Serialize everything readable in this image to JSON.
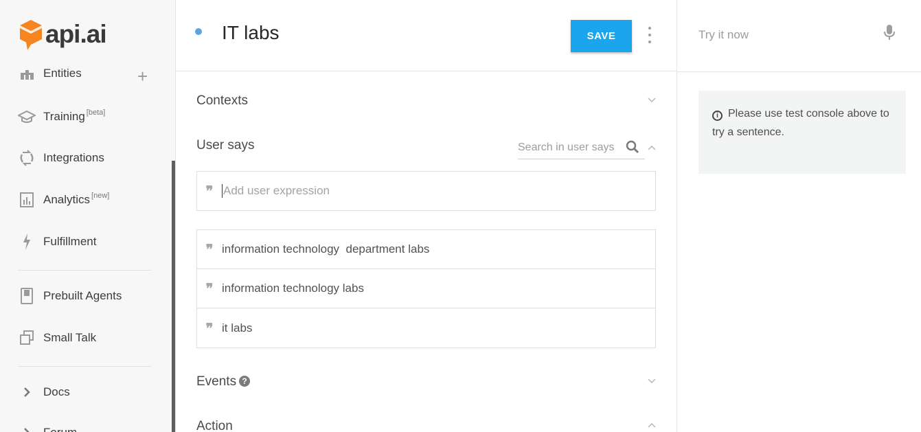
{
  "logo": {
    "text": "api.ai",
    "brand_color": "#f6841f"
  },
  "sidebar": {
    "items": [
      {
        "label": "Entities",
        "icon": "entities-icon",
        "sup": ""
      },
      {
        "label": "Training",
        "icon": "graduation-cap-icon",
        "sup": "[beta]"
      },
      {
        "label": "Integrations",
        "icon": "sync-icon",
        "sup": ""
      },
      {
        "label": "Analytics",
        "icon": "bar-chart-icon",
        "sup": "[new]"
      },
      {
        "label": "Fulfillment",
        "icon": "lightning-icon",
        "sup": ""
      },
      {
        "label": "Prebuilt Agents",
        "icon": "book-icon",
        "sup": ""
      },
      {
        "label": "Small Talk",
        "icon": "chat-copy-icon",
        "sup": ""
      },
      {
        "label": "Docs",
        "icon": "chevron-right-icon",
        "sup": ""
      },
      {
        "label": "Forum",
        "icon": "chevron-right-icon",
        "sup": ""
      }
    ],
    "add_symbol": "+"
  },
  "header": {
    "title": "IT labs",
    "save_label": "SAVE",
    "status_color": "#5ba4e2"
  },
  "main": {
    "contexts_label": "Contexts",
    "user_says_label": "User says",
    "search_placeholder": "Search in user says",
    "add_expression_placeholder": "Add user expression",
    "expressions": [
      "information technology  department labs",
      "information technology labs",
      "it labs"
    ],
    "events_label": "Events",
    "events_help": "?",
    "action_label": "Action"
  },
  "right_panel": {
    "try_placeholder": "Try it now",
    "notice_icon": "i",
    "notice_text": "Please use test console above to try a sentence."
  },
  "colors": {
    "accent": "#1aa5ec",
    "sidebar_bg": "#f7f7f7"
  }
}
